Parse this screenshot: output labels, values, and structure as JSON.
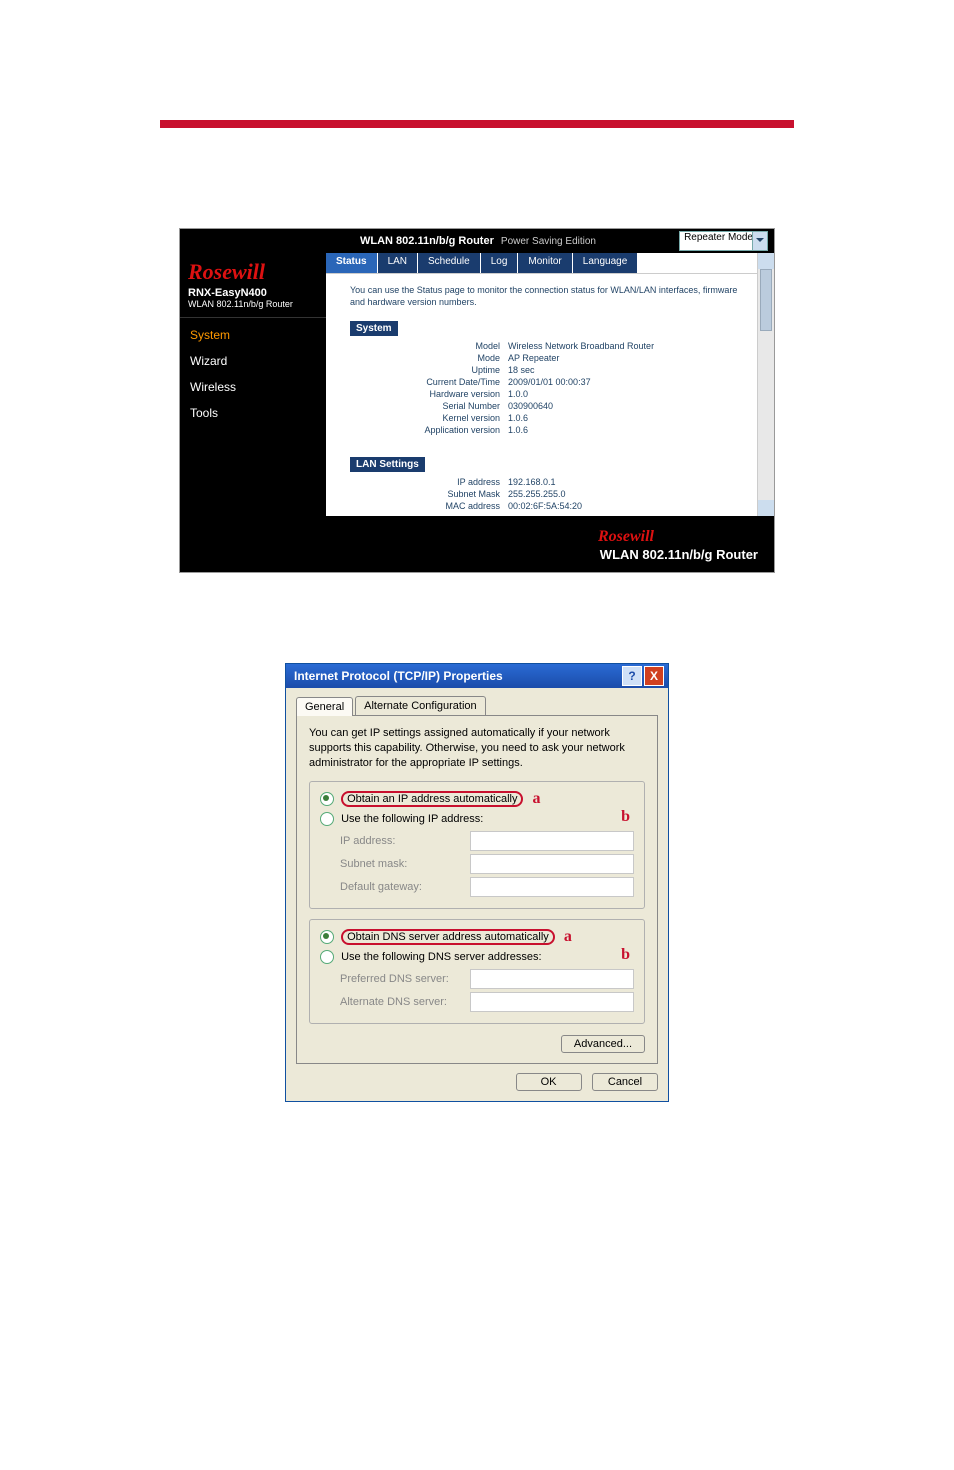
{
  "router": {
    "header": {
      "title": "WLAN 802.11n/b/g Router",
      "subtitle": "Power Saving Edition",
      "mode_select": "Repeater Mode"
    },
    "brand": "Rosewill",
    "model": "RNX-EasyN400",
    "model_desc": "WLAN 802.11n/b/g Router",
    "nav": {
      "system": "System",
      "wizard": "Wizard",
      "wireless": "Wireless",
      "tools": "Tools"
    },
    "tabs": {
      "status": "Status",
      "lan": "LAN",
      "schedule": "Schedule",
      "log": "Log",
      "monitor": "Monitor",
      "language": "Language"
    },
    "description": "You can use the Status page to monitor the connection status for WLAN/LAN interfaces, firmware and hardware version numbers.",
    "system_section": {
      "label": "System",
      "items": {
        "model_k": "Model",
        "model_v": "Wireless Network Broadband Router",
        "mode_k": "Mode",
        "mode_v": "AP Repeater",
        "uptime_k": "Uptime",
        "uptime_v": "18 sec",
        "dt_k": "Current Date/Time",
        "dt_v": "2009/01/01 00:00:37",
        "hw_k": "Hardware version",
        "hw_v": "1.0.0",
        "sn_k": "Serial Number",
        "sn_v": "030900640",
        "kv_k": "Kernel version",
        "kv_v": "1.0.6",
        "av_k": "Application version",
        "av_v": "1.0.6"
      }
    },
    "lan_section": {
      "label": "LAN Settings",
      "items": {
        "ip_k": "IP address",
        "ip_v": "192.168.0.1",
        "sm_k": "Subnet Mask",
        "sm_v": "255.255.255.0",
        "mac_k": "MAC address",
        "mac_v": "00:02:6F:5A:54:20"
      }
    },
    "footer_brand": "Rosewill",
    "footer_title": "WLAN 802.11n/b/g Router"
  },
  "tcpip": {
    "title": "Internet Protocol (TCP/IP) Properties",
    "tab_general": "General",
    "tab_alt": "Alternate Configuration",
    "blurb": "You can get IP settings assigned automatically if your network supports this capability. Otherwise, you need to ask your network administrator for the appropriate IP settings.",
    "radio_ip_auto": "Obtain an IP address automatically",
    "radio_ip_manual": "Use the following IP address:",
    "lbl_ip": "IP address:",
    "lbl_mask": "Subnet mask:",
    "lbl_gw": "Default gateway:",
    "radio_dns_auto": "Obtain DNS server address automatically",
    "radio_dns_manual": "Use the following DNS server addresses:",
    "lbl_dns1": "Preferred DNS server:",
    "lbl_dns2": "Alternate DNS server:",
    "btn_advanced": "Advanced...",
    "btn_ok": "OK",
    "btn_cancel": "Cancel",
    "letter_a": "a",
    "letter_b": "b"
  },
  "titlebar_help": "?",
  "titlebar_close": "X"
}
